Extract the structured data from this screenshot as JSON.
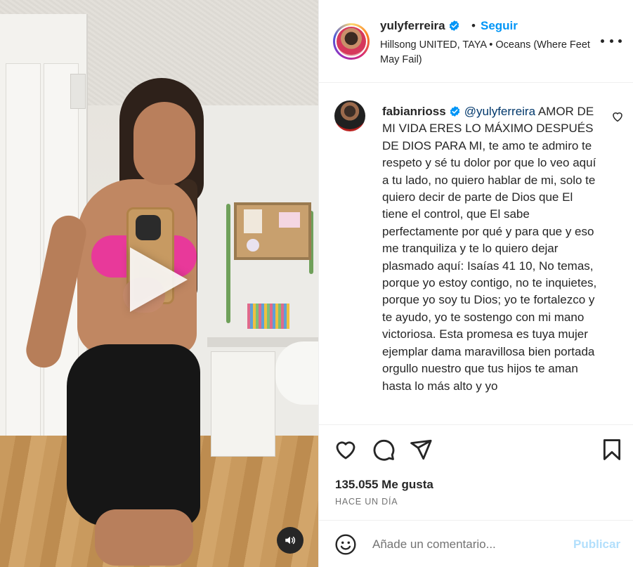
{
  "post": {
    "username": "yulyferreira",
    "separator": "•",
    "follow_label": "Seguir",
    "song": "Hillsong UNITED, TAYA • Oceans (Where Feet May Fail)"
  },
  "comment": {
    "username": "fabianrioss",
    "mention": "@yulyferreira",
    "text": " AMOR DE MI VIDA ERES LO MÁXIMO DESPUÉS DE DIOS PARA MI, te amo te admiro te respeto y sé tu dolor por que lo veo aquí a tu lado, no quiero hablar de mi, solo te quiero decir de parte de Dios que El tiene el control, que El sabe perfectamente por qué y para que y eso me tranquiliza y te lo quiero dejar plasmado aquí: Isaías 41 10, No temas, porque yo estoy contigo, no te inquietes, porque yo soy tu Dios; yo te fortalezco y te ayudo, yo te sostengo con mi mano victoriosa. Esta promesa es tuya mujer ejemplar dama maravillosa bien portada orgullo nuestro que tus hijos te aman hasta lo más alto y yo"
  },
  "stats": {
    "likes": "135.055 Me gusta",
    "timestamp": "HACE UN DÍA"
  },
  "compose": {
    "placeholder": "Añade un comentario...",
    "publish_label": "Publicar"
  },
  "icons": {
    "verified": "verified-badge-icon",
    "more": "more-options-icon",
    "like": "heart-icon",
    "comment": "comment-bubble-icon",
    "share": "paper-plane-icon",
    "save": "bookmark-icon",
    "emoji": "emoji-smile-icon",
    "sound": "speaker-icon",
    "play": "play-icon"
  },
  "colors": {
    "accent": "#0095f6",
    "verified": "#0095f6",
    "publish_disabled": "#b2dffc",
    "mention": "#00376b"
  }
}
